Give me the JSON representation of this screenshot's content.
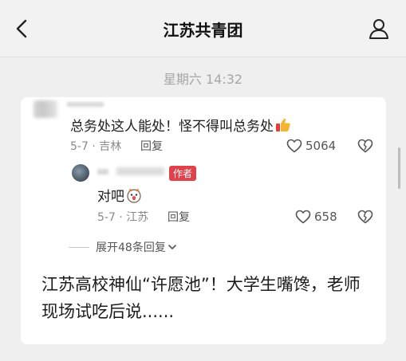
{
  "header": {
    "title": "江苏共青团",
    "back_icon": "chevron-left-icon",
    "profile_icon": "person-icon"
  },
  "timestamp": "星期六 14:32",
  "comment": {
    "text": "总务处这人能处！怪不得叫总务处",
    "emoji": "thumbs-up-icon",
    "date_location": "5-7 · 吉林",
    "reply_label": "回复",
    "like_count": "5064"
  },
  "reply": {
    "badge": "作者",
    "text": "对吧",
    "emoji": "dog-face-icon",
    "date_location": "5-7 · 江苏",
    "reply_label": "回复",
    "like_count": "658"
  },
  "expand_replies": "展开48条回复",
  "article": {
    "title": "江苏高校神仙“许愿池”！大学生嘴馋，老师现场试吃后说......"
  },
  "colors": {
    "badge_red": "#e0424a",
    "background": "#efefef",
    "card": "#ffffff"
  }
}
